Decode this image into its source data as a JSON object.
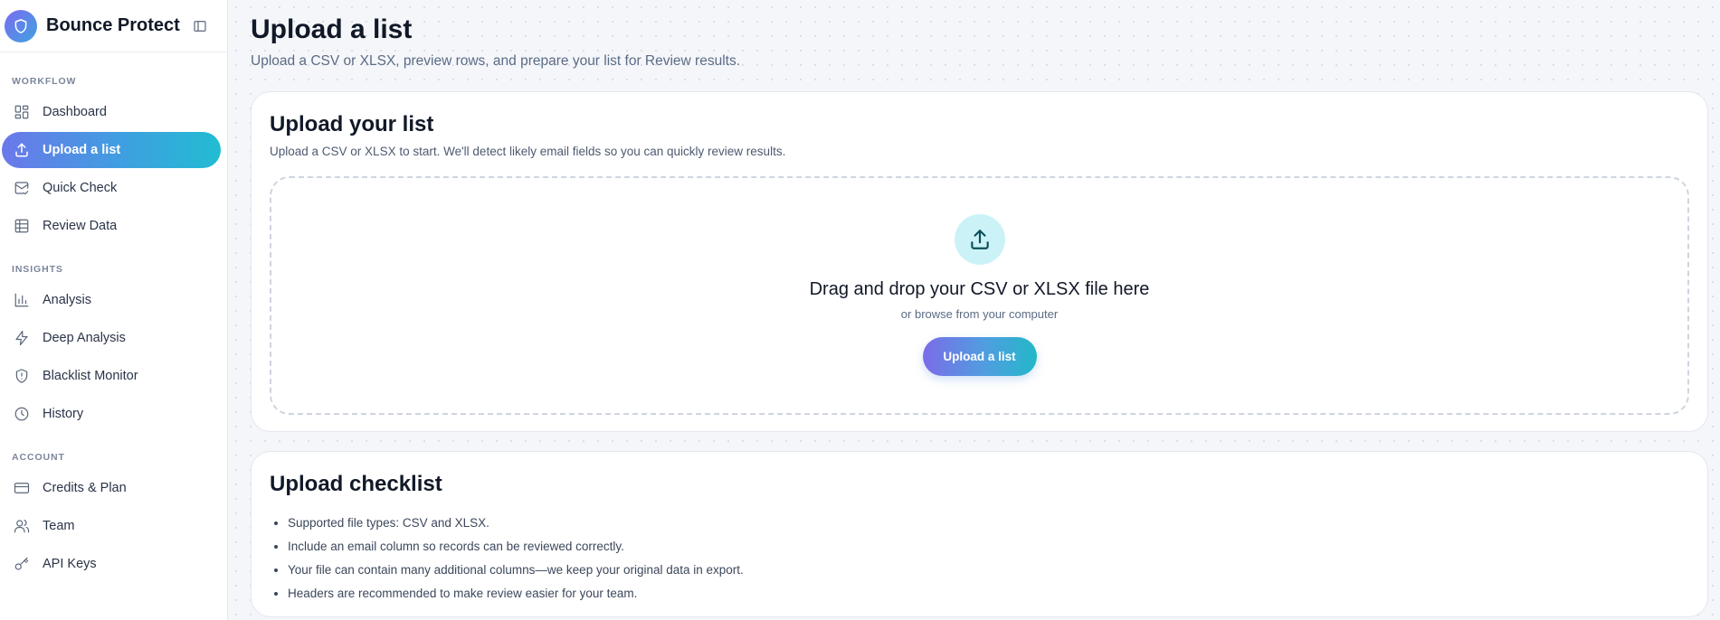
{
  "app": {
    "name": "Bounce Protect"
  },
  "sidebar": {
    "sections": {
      "workflow": "WORKFLOW",
      "insights": "INSIGHTS",
      "account": "ACCOUNT"
    },
    "items": [
      {
        "label": "Dashboard",
        "icon": "dashboard-icon"
      },
      {
        "label": "Upload a list",
        "icon": "upload-icon",
        "active": true
      },
      {
        "label": "Quick Check",
        "icon": "mail-check-icon"
      },
      {
        "label": "Review Data",
        "icon": "table-icon"
      },
      {
        "label": "Analysis",
        "icon": "bar-chart-icon"
      },
      {
        "label": "Deep Analysis",
        "icon": "lightning-icon"
      },
      {
        "label": "Blacklist Monitor",
        "icon": "shield-alert-icon"
      },
      {
        "label": "History",
        "icon": "clock-icon"
      },
      {
        "label": "Credits & Plan",
        "icon": "credit-card-icon"
      },
      {
        "label": "Team",
        "icon": "users-icon"
      },
      {
        "label": "API Keys",
        "icon": "key-icon"
      }
    ]
  },
  "page": {
    "title": "Upload a list",
    "subtitle": "Upload a CSV or XLSX, preview rows, and prepare your list for Review results."
  },
  "upload_card": {
    "title": "Upload your list",
    "description": "Upload a CSV or XLSX to start. We'll detect likely email fields so you can quickly review results.",
    "dropzone": {
      "title": "Drag and drop your CSV or XLSX file here",
      "subtitle": "or browse from your computer",
      "button_label": "Upload a list"
    }
  },
  "checklist_card": {
    "title": "Upload checklist",
    "items": [
      "Supported file types: CSV and XLSX.",
      "Include an email column so records can be reviewed correctly.",
      "Your file can contain many additional columns—we keep your original data in export.",
      "Headers are recommended to make review easier for your team."
    ]
  },
  "colors": {
    "accent_start": "#7b6ce8",
    "accent_end": "#21bcd2",
    "upload_icon_bg": "#cbf3f7"
  }
}
